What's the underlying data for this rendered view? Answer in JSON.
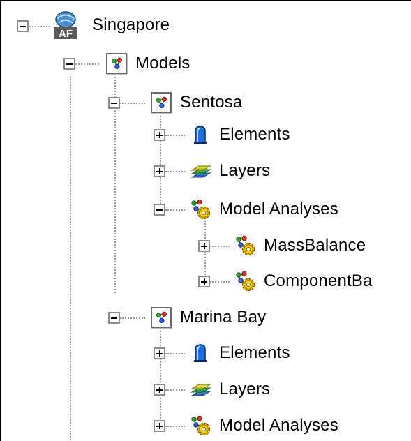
{
  "tree": {
    "root": {
      "label": "Singapore",
      "icon": "af-server-icon",
      "logo_text": "AF",
      "expanded": true
    },
    "models": {
      "label": "Models",
      "icon": "model-icon",
      "expanded": true
    },
    "sentosa": {
      "label": "Sentosa",
      "icon": "model-icon",
      "expanded": true,
      "elements": {
        "label": "Elements",
        "icon": "element-icon",
        "expanded": false
      },
      "layers": {
        "label": "Layers",
        "icon": "layers-icon",
        "expanded": false
      },
      "analyses": {
        "label": "Model Analyses",
        "icon": "analysis-icon",
        "expanded": true,
        "items": [
          {
            "label": "MassBalance",
            "icon": "analysis-icon",
            "expanded": false
          },
          {
            "label": "ComponentBa",
            "icon": "analysis-icon",
            "expanded": false
          }
        ]
      }
    },
    "marina_bay": {
      "label": "Marina Bay",
      "icon": "model-icon",
      "expanded": true,
      "elements": {
        "label": "Elements",
        "icon": "element-icon",
        "expanded": false
      },
      "layers": {
        "label": "Layers",
        "icon": "layers-icon",
        "expanded": false
      },
      "analyses": {
        "label": "Model Analyses",
        "icon": "analysis-icon",
        "expanded": false
      }
    }
  }
}
